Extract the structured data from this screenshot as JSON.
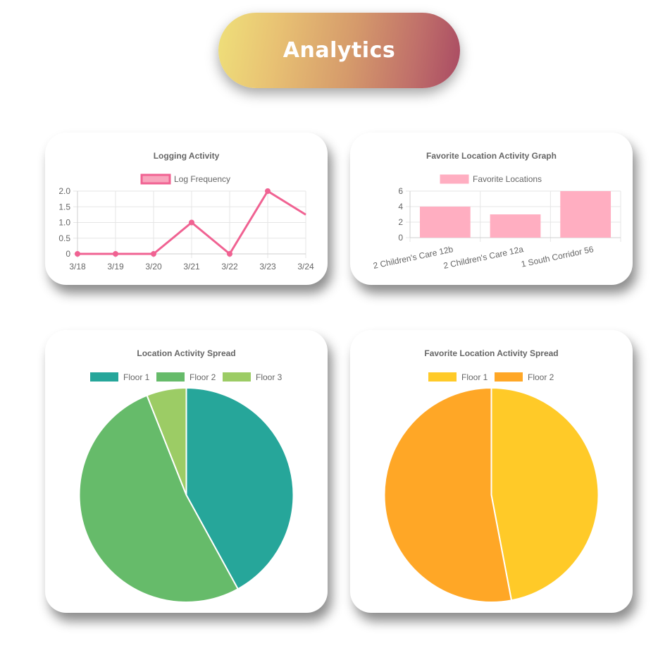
{
  "header": {
    "title": "Analytics"
  },
  "colors": {
    "log_line": "#f06292",
    "log_fill": "#f8a5bd",
    "fav_bar": "#ffaec1",
    "floor1_teal": "#26a69a",
    "floor2_green": "#66bb6a",
    "floor3_lime": "#9ccc65",
    "fav_floor1": "#ffca28",
    "fav_floor2": "#ffa726"
  },
  "chart_data": [
    {
      "type": "line",
      "title": "Logging Activity",
      "legend_position": "top",
      "x": [
        "3/18",
        "3/19",
        "3/20",
        "3/21",
        "3/22",
        "3/23",
        "3/24"
      ],
      "series": [
        {
          "name": "Log Frequency",
          "values": [
            0,
            0,
            0,
            1,
            0,
            2,
            1.25
          ]
        }
      ],
      "ylim": [
        0,
        2.0
      ],
      "yticks": [
        "2.0",
        "1.5",
        "1.0",
        "0.5",
        "0"
      ],
      "grid": true
    },
    {
      "type": "bar",
      "title": "Favorite Location Activity Graph",
      "legend_position": "top",
      "categories": [
        "2 Children's Care 12b",
        "2 Children's Care 12a",
        "1 South Corridor 56"
      ],
      "series": [
        {
          "name": "Favorite Locations",
          "values": [
            4,
            3,
            6
          ]
        }
      ],
      "ylim": [
        0,
        6
      ],
      "yticks": [
        "6",
        "4",
        "2",
        "0"
      ],
      "grid": true
    },
    {
      "type": "pie",
      "title": "Location Activity Spread",
      "legend_position": "top",
      "labels": [
        "Floor 1",
        "Floor 2",
        "Floor 3"
      ],
      "values": [
        42,
        52,
        6
      ]
    },
    {
      "type": "pie",
      "title": "Favorite Location Activity Spread",
      "legend_position": "top",
      "labels": [
        "Floor 1",
        "Floor 2"
      ],
      "values": [
        47,
        53
      ]
    }
  ]
}
